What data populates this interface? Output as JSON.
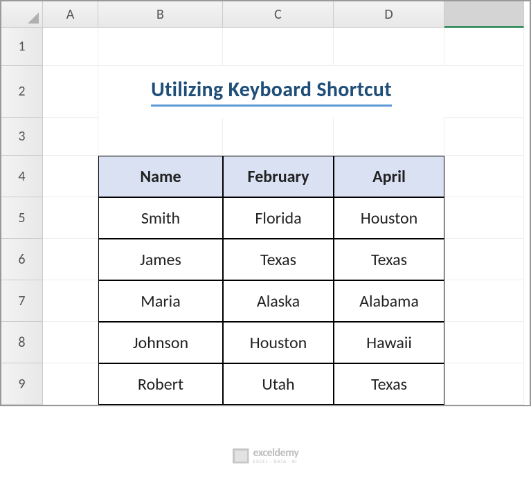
{
  "columns": [
    "A",
    "B",
    "C",
    "D",
    ""
  ],
  "rows": [
    "1",
    "2",
    "3",
    "4",
    "5",
    "6",
    "7",
    "8",
    "9"
  ],
  "title": "Utilizing Keyboard Shortcut",
  "chart_data": {
    "type": "table",
    "title": "Utilizing Keyboard Shortcut",
    "headers": [
      "Name",
      "February",
      "April"
    ],
    "rows": [
      [
        "Smith",
        "Florida",
        "Houston"
      ],
      [
        "James",
        "Texas",
        "Texas"
      ],
      [
        "Maria",
        "Alaska",
        "Alabama"
      ],
      [
        "Johnson",
        "Houston",
        "Hawaii"
      ],
      [
        "Robert",
        "Utah",
        "Texas"
      ]
    ]
  },
  "watermark": {
    "main": "exceldemy",
    "sub": "EXCEL · DATA · BI"
  }
}
